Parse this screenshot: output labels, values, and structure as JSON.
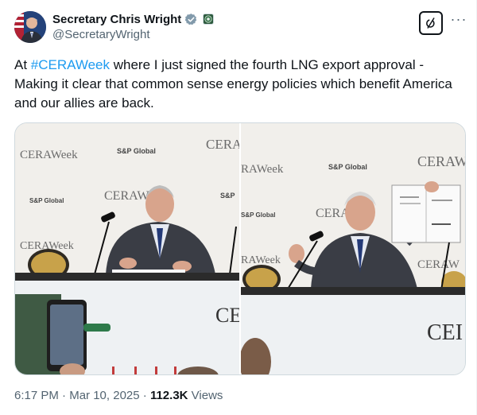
{
  "author": {
    "display_name": "Secretary Chris Wright",
    "handle": "@SecretaryWright",
    "verified_icon": "verified-badge-icon",
    "org_badge_icon": "department-seal-icon"
  },
  "actions": {
    "grok_icon": "grok-icon",
    "more_icon": "more-options-icon",
    "more_label": "···"
  },
  "tweet": {
    "text_before": "At ",
    "hashtag": "#CERAWeek",
    "text_after": " where I just signed the fourth LNG export approval - Making it clear that common sense energy policies which benefit America and our allies are back."
  },
  "media": {
    "photo1_alt": "Secretary signing a document at a CERAWeek press table",
    "photo2_alt": "Secretary holding up a signed document at a CERAWeek press table",
    "banner_ceraweek": "CERAWeek",
    "banner_sp": "S&P Global",
    "table_sign": "CE"
  },
  "meta": {
    "time": "6:17 PM",
    "separator": " · ",
    "date": "Mar 10, 2025",
    "views_count": "112.3K",
    "views_label": " Views"
  },
  "colors": {
    "accent": "#1d9bf0",
    "text_primary": "#0f1419",
    "text_secondary": "#536471"
  }
}
